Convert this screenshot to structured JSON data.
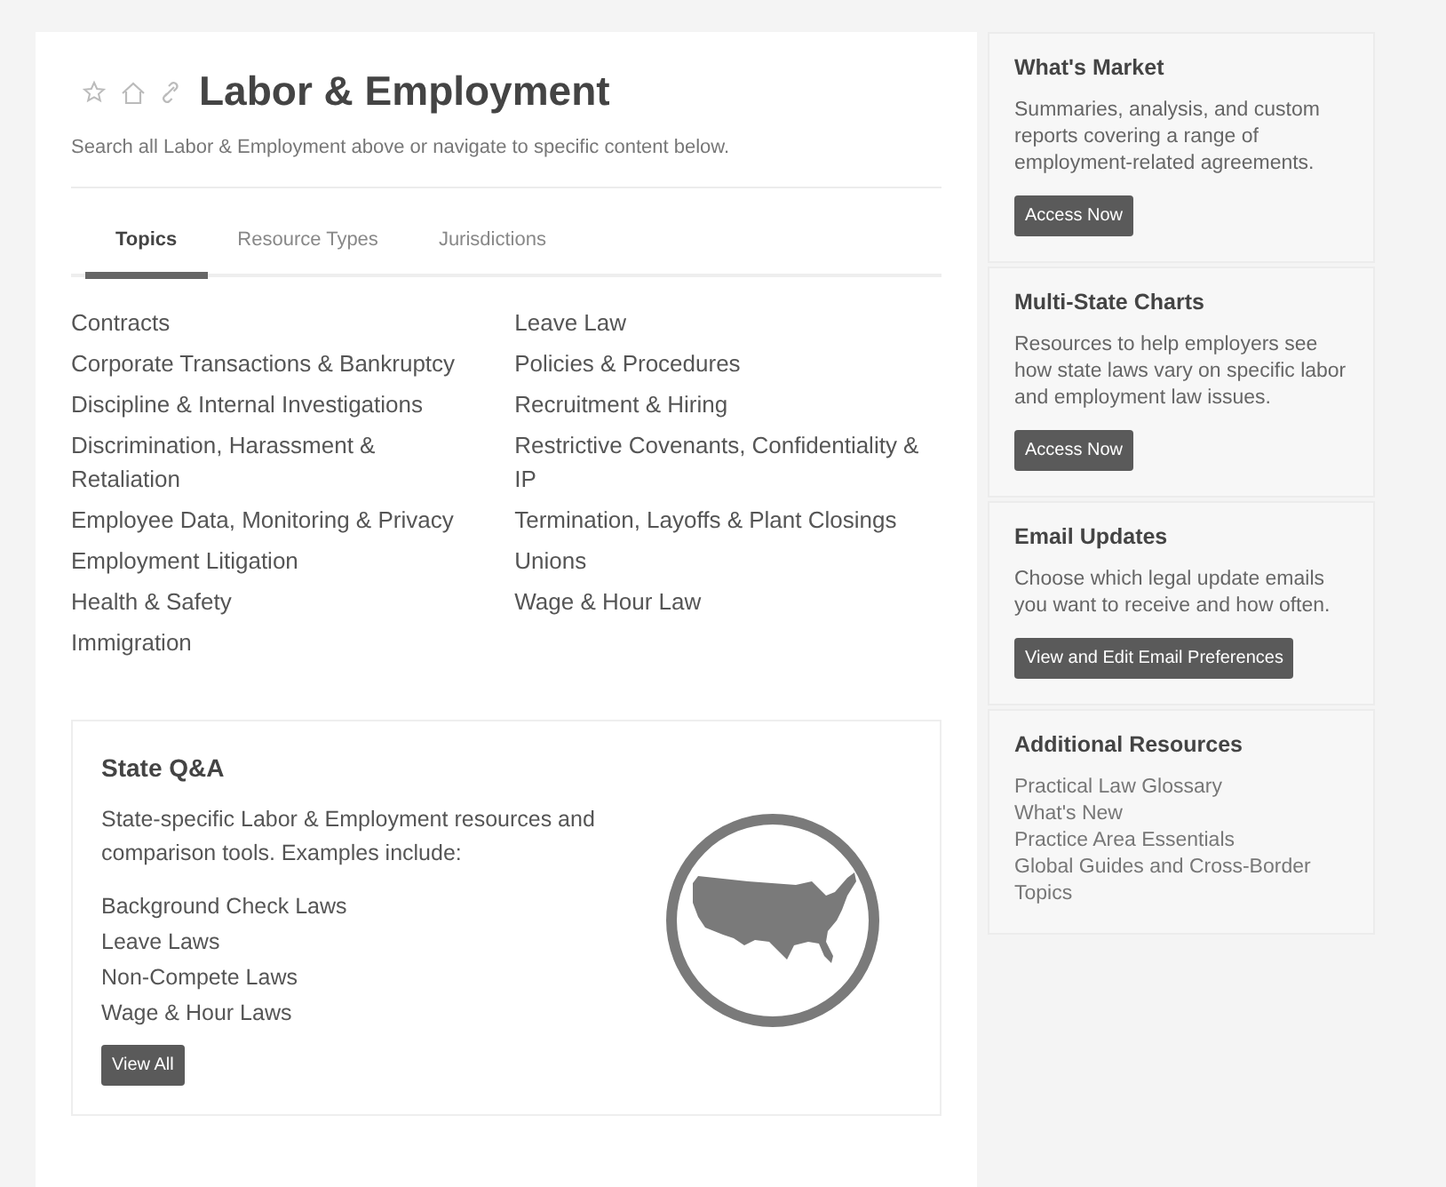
{
  "page": {
    "title": "Labor & Employment",
    "subtitle": "Search all Labor & Employment above or navigate to specific content below."
  },
  "tabs": [
    {
      "label": "Topics",
      "selected": true
    },
    {
      "label": "Resource Types",
      "selected": false
    },
    {
      "label": "Jurisdictions",
      "selected": false
    }
  ],
  "topics": {
    "columns": [
      [
        "Contracts",
        "Corporate Transactions & Bankruptcy",
        "Discipline & Internal Investigations",
        "Discrimination, Harassment & Retaliation",
        "Employee Data, Monitoring & Privacy",
        "Employment Litigation",
        "Health & Safety",
        "Immigration"
      ],
      [
        "Leave Law",
        "Policies & Procedures",
        "Recruitment & Hiring",
        "Restrictive Covenants, Confidentiality & IP",
        "Termination, Layoffs & Plant Closings",
        "Unions",
        "Wage & Hour Law"
      ]
    ]
  },
  "state_qa": {
    "title": "State Q&A",
    "description": "State-specific Labor & Employment resources and comparison tools. Examples include:",
    "examples": [
      "Background Check Laws",
      "Leave Laws",
      "Non-Compete Laws",
      "Wage & Hour Laws"
    ],
    "button": "View All"
  },
  "sidebar": [
    {
      "kind": "button",
      "title": "What's Market",
      "text": "Summaries, analysis, and custom reports covering a range of employment-related agreements.",
      "button": "Access Now"
    },
    {
      "kind": "button",
      "title": "Multi-State Charts",
      "text": "Resources to help employers see how state laws vary on specific labor and employment law issues.",
      "button": "Access Now"
    },
    {
      "kind": "button",
      "title": "Email Updates",
      "text": "Choose which legal update emails you want to receive and how often.",
      "button": "View and Edit Email Preferences"
    },
    {
      "kind": "links",
      "title": "Additional Resources",
      "links": [
        "Practical Law Glossary",
        "What's New",
        "Practice Area Essentials",
        "Global Guides and Cross-Border Topics"
      ]
    }
  ]
}
